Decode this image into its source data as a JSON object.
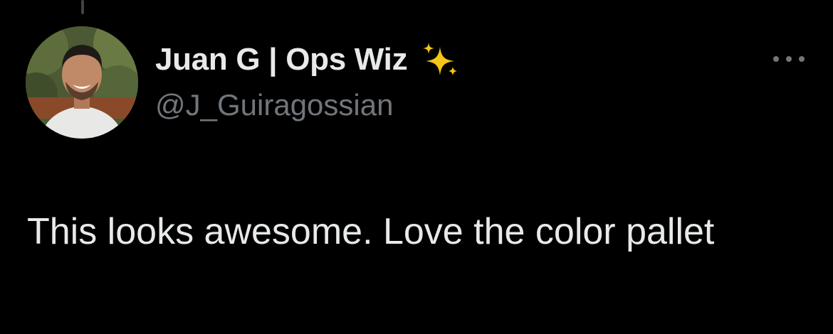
{
  "tweet": {
    "author": {
      "display_name": "Juan G | Ops Wiz",
      "handle": "@J_Guiragossian",
      "badge_icon": "sparkles-icon"
    },
    "text": "This looks awesome. Love the color pallet",
    "more_icon": "more-horizontal-icon"
  },
  "colors": {
    "background": "#000000",
    "primary_text": "#e7e9ea",
    "secondary_text": "#71767b",
    "sparkle": "#f5c518"
  }
}
